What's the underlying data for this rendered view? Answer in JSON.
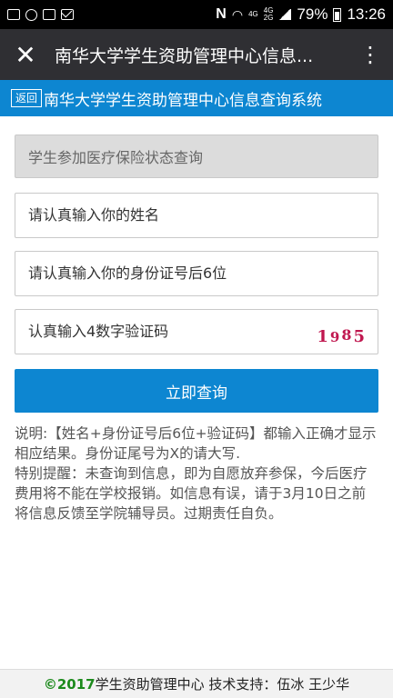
{
  "status_bar": {
    "net_type": "4G",
    "net_type2": "4G",
    "net_type3": "2G",
    "battery": "79%",
    "time": "13:26"
  },
  "app_bar": {
    "close_icon": "close-icon",
    "title": "南华大学学生资助管理中心信息...",
    "more_icon": "more-vertical-icon"
  },
  "header": {
    "back_label": "返回",
    "site_title": "南华大学学生资助管理中心信息查询系统"
  },
  "form": {
    "query_type": "学生参加医疗保险状态查询",
    "name_placeholder": "请认真输入你的姓名",
    "id_placeholder": "请认真输入你的身份证号后6位",
    "captcha_placeholder": "认真输入4数字验证码",
    "captcha_digits": [
      "1",
      "9",
      "8",
      "5"
    ],
    "submit_label": "立即查询"
  },
  "note": {
    "line1": "说明:【姓名+身份证号后6位+验证码】都输入正确才显示相应结果。身份证尾号为X的请大写.",
    "line2": "特别提醒：未查询到信息，即为自愿放弃参保，今后医疗费用将不能在学校报销。如信息有误，请于3月10日之前将信息反馈至学院辅导员。过期责任自负。"
  },
  "footer": {
    "copyright": "©2017",
    "text": " 学生资助管理中心  技术支持：伍冰 王少华"
  },
  "colors": {
    "accent_blue": "#0d86d1",
    "app_bar": "#2f2f33",
    "captcha": "#c0174f",
    "footer_copy": "#1c8a1c"
  }
}
